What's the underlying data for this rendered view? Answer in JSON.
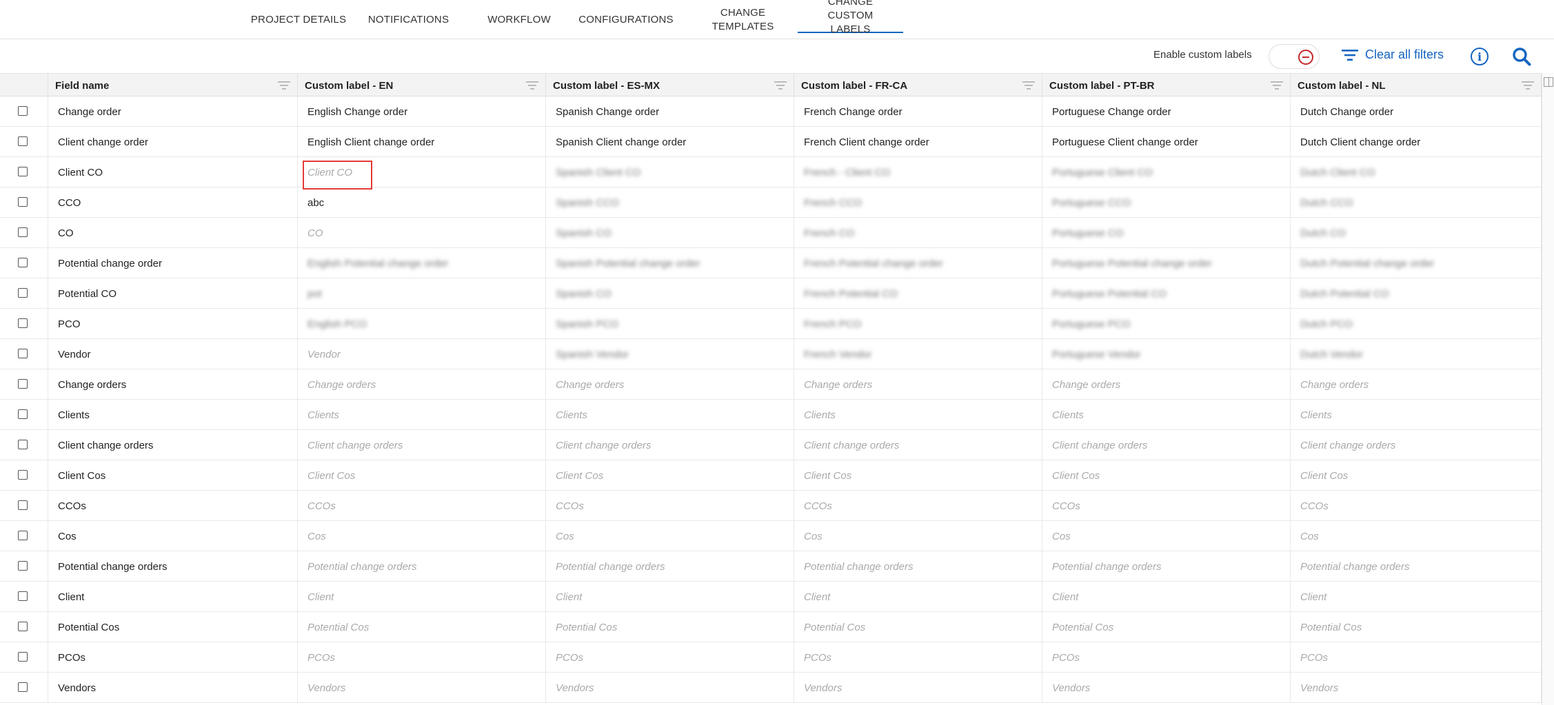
{
  "tabs": [
    {
      "label": "PROJECT DETAILS"
    },
    {
      "label": "NOTIFICATIONS"
    },
    {
      "label": "WORKFLOW"
    },
    {
      "label": "CONFIGURATIONS"
    },
    {
      "label": "CHANGE TEMPLATES"
    },
    {
      "label": "CHANGE CUSTOM LABELS",
      "active": true
    }
  ],
  "toolbar": {
    "toggle_label": "Enable custom labels",
    "clear_filters_label": "Clear all filters",
    "toggle_state": "off"
  },
  "table": {
    "columns": [
      "Field name",
      "Custom label - EN",
      "Custom label - ES-MX",
      "Custom label - FR-CA",
      "Custom label - PT-BR",
      "Custom label - NL"
    ],
    "rows": [
      {
        "field": "Change order",
        "cells": [
          {
            "text": "English Change order",
            "style": "filled"
          },
          {
            "text": "Spanish Change order",
            "style": "filled"
          },
          {
            "text": "French Change order",
            "style": "filled"
          },
          {
            "text": "Portuguese Change order",
            "style": "filled"
          },
          {
            "text": "Dutch Change order",
            "style": "filled"
          }
        ]
      },
      {
        "field": "Client change order",
        "cells": [
          {
            "text": "English Client change order",
            "style": "filled"
          },
          {
            "text": "Spanish Client change order",
            "style": "filled"
          },
          {
            "text": "French Client change order",
            "style": "filled"
          },
          {
            "text": "Portuguese Client change order",
            "style": "filled"
          },
          {
            "text": "Dutch Client change order",
            "style": "filled"
          }
        ]
      },
      {
        "field": "Client CO",
        "cells": [
          {
            "text": "Client CO",
            "style": "ph"
          },
          {
            "text": "Spanish Client CO",
            "style": "blur"
          },
          {
            "text": "French - Client CO",
            "style": "blur"
          },
          {
            "text": "Portuguese Client CO",
            "style": "blur"
          },
          {
            "text": "Dutch Client CO",
            "style": "blur"
          }
        ]
      },
      {
        "field": "CCO",
        "cells": [
          {
            "text": "abc",
            "style": "filled"
          },
          {
            "text": "Spanish CCO",
            "style": "blur"
          },
          {
            "text": "French CCO",
            "style": "blur"
          },
          {
            "text": "Portuguese CCO",
            "style": "blur"
          },
          {
            "text": "Dutch CCO",
            "style": "blur"
          }
        ]
      },
      {
        "field": "CO",
        "cells": [
          {
            "text": "CO",
            "style": "ph"
          },
          {
            "text": "Spanish CO",
            "style": "blur"
          },
          {
            "text": "French CO",
            "style": "blur"
          },
          {
            "text": "Portuguese CO",
            "style": "blur"
          },
          {
            "text": "Dutch CO",
            "style": "blur"
          }
        ]
      },
      {
        "field": "Potential change order",
        "cells": [
          {
            "text": "English Potential change order",
            "style": "blur"
          },
          {
            "text": "Spanish Potential change order",
            "style": "blur"
          },
          {
            "text": "French Potential change order",
            "style": "blur"
          },
          {
            "text": "Portuguese Potential change order",
            "style": "blur"
          },
          {
            "text": "Dutch Potential change order",
            "style": "blur"
          }
        ]
      },
      {
        "field": "Potential CO",
        "cells": [
          {
            "text": "pot",
            "style": "blur"
          },
          {
            "text": "Spanish CO",
            "style": "blur"
          },
          {
            "text": "French Potential CO",
            "style": "blur"
          },
          {
            "text": "Portuguese Potential CO",
            "style": "blur"
          },
          {
            "text": "Dutch Potential CO",
            "style": "blur"
          }
        ]
      },
      {
        "field": "PCO",
        "cells": [
          {
            "text": "English PCO",
            "style": "blur"
          },
          {
            "text": "Spanish PCO",
            "style": "blur"
          },
          {
            "text": "French PCO",
            "style": "blur"
          },
          {
            "text": "Portuguese PCO",
            "style": "blur"
          },
          {
            "text": "Dutch PCO",
            "style": "blur"
          }
        ]
      },
      {
        "field": "Vendor",
        "cells": [
          {
            "text": "Vendor",
            "style": "ph"
          },
          {
            "text": "Spanish Vendor",
            "style": "blur"
          },
          {
            "text": "French Vendor",
            "style": "blur"
          },
          {
            "text": "Portuguese Vendor",
            "style": "blur"
          },
          {
            "text": "Dutch Vendor",
            "style": "blur"
          }
        ]
      },
      {
        "field": "Change orders",
        "cells": [
          {
            "text": "Change orders",
            "style": "ph"
          },
          {
            "text": "Change orders",
            "style": "ph"
          },
          {
            "text": "Change orders",
            "style": "ph"
          },
          {
            "text": "Change orders",
            "style": "ph"
          },
          {
            "text": "Change orders",
            "style": "ph"
          }
        ]
      },
      {
        "field": "Clients",
        "cells": [
          {
            "text": "Clients",
            "style": "ph"
          },
          {
            "text": "Clients",
            "style": "ph"
          },
          {
            "text": "Clients",
            "style": "ph"
          },
          {
            "text": "Clients",
            "style": "ph"
          },
          {
            "text": "Clients",
            "style": "ph"
          }
        ]
      },
      {
        "field": "Client change orders",
        "cells": [
          {
            "text": "Client change orders",
            "style": "ph"
          },
          {
            "text": "Client change orders",
            "style": "ph"
          },
          {
            "text": "Client change orders",
            "style": "ph"
          },
          {
            "text": "Client change orders",
            "style": "ph"
          },
          {
            "text": "Client change orders",
            "style": "ph"
          }
        ]
      },
      {
        "field": "Client Cos",
        "cells": [
          {
            "text": "Client Cos",
            "style": "ph"
          },
          {
            "text": "Client Cos",
            "style": "ph"
          },
          {
            "text": "Client Cos",
            "style": "ph"
          },
          {
            "text": "Client Cos",
            "style": "ph"
          },
          {
            "text": "Client Cos",
            "style": "ph"
          }
        ]
      },
      {
        "field": "CCOs",
        "cells": [
          {
            "text": "CCOs",
            "style": "ph"
          },
          {
            "text": "CCOs",
            "style": "ph"
          },
          {
            "text": "CCOs",
            "style": "ph"
          },
          {
            "text": "CCOs",
            "style": "ph"
          },
          {
            "text": "CCOs",
            "style": "ph"
          }
        ]
      },
      {
        "field": "Cos",
        "cells": [
          {
            "text": "Cos",
            "style": "ph"
          },
          {
            "text": "Cos",
            "style": "ph"
          },
          {
            "text": "Cos",
            "style": "ph"
          },
          {
            "text": "Cos",
            "style": "ph"
          },
          {
            "text": "Cos",
            "style": "ph"
          }
        ]
      },
      {
        "field": "Potential change orders",
        "cells": [
          {
            "text": "Potential change orders",
            "style": "ph"
          },
          {
            "text": "Potential change orders",
            "style": "ph"
          },
          {
            "text": "Potential change orders",
            "style": "ph"
          },
          {
            "text": "Potential change orders",
            "style": "ph"
          },
          {
            "text": "Potential change orders",
            "style": "ph"
          }
        ]
      },
      {
        "field": "Client",
        "cells": [
          {
            "text": "Client",
            "style": "ph"
          },
          {
            "text": "Client",
            "style": "ph"
          },
          {
            "text": "Client",
            "style": "ph"
          },
          {
            "text": "Client",
            "style": "ph"
          },
          {
            "text": "Client",
            "style": "ph"
          }
        ]
      },
      {
        "field": "Potential Cos",
        "cells": [
          {
            "text": "Potential Cos",
            "style": "ph"
          },
          {
            "text": "Potential Cos",
            "style": "ph"
          },
          {
            "text": "Potential Cos",
            "style": "ph"
          },
          {
            "text": "Potential Cos",
            "style": "ph"
          },
          {
            "text": "Potential Cos",
            "style": "ph"
          }
        ]
      },
      {
        "field": "PCOs",
        "cells": [
          {
            "text": "PCOs",
            "style": "ph"
          },
          {
            "text": "PCOs",
            "style": "ph"
          },
          {
            "text": "PCOs",
            "style": "ph"
          },
          {
            "text": "PCOs",
            "style": "ph"
          },
          {
            "text": "PCOs",
            "style": "ph"
          }
        ]
      },
      {
        "field": "Vendors",
        "cells": [
          {
            "text": "Vendors",
            "style": "ph"
          },
          {
            "text": "Vendors",
            "style": "ph"
          },
          {
            "text": "Vendors",
            "style": "ph"
          },
          {
            "text": "Vendors",
            "style": "ph"
          },
          {
            "text": "Vendors",
            "style": "ph"
          }
        ]
      }
    ]
  },
  "colors": {
    "accent": "#1565c0",
    "toggle_off": "#c62828",
    "selection_outline": "#e53935",
    "header_bg": "#f3f3f3",
    "placeholder_text": "#aaaaaa"
  },
  "icons": [
    "filter-lines-icon",
    "info-icon",
    "search-icon",
    "column-filter-icon",
    "toggle-off-icon",
    "side-panel-icon"
  ]
}
